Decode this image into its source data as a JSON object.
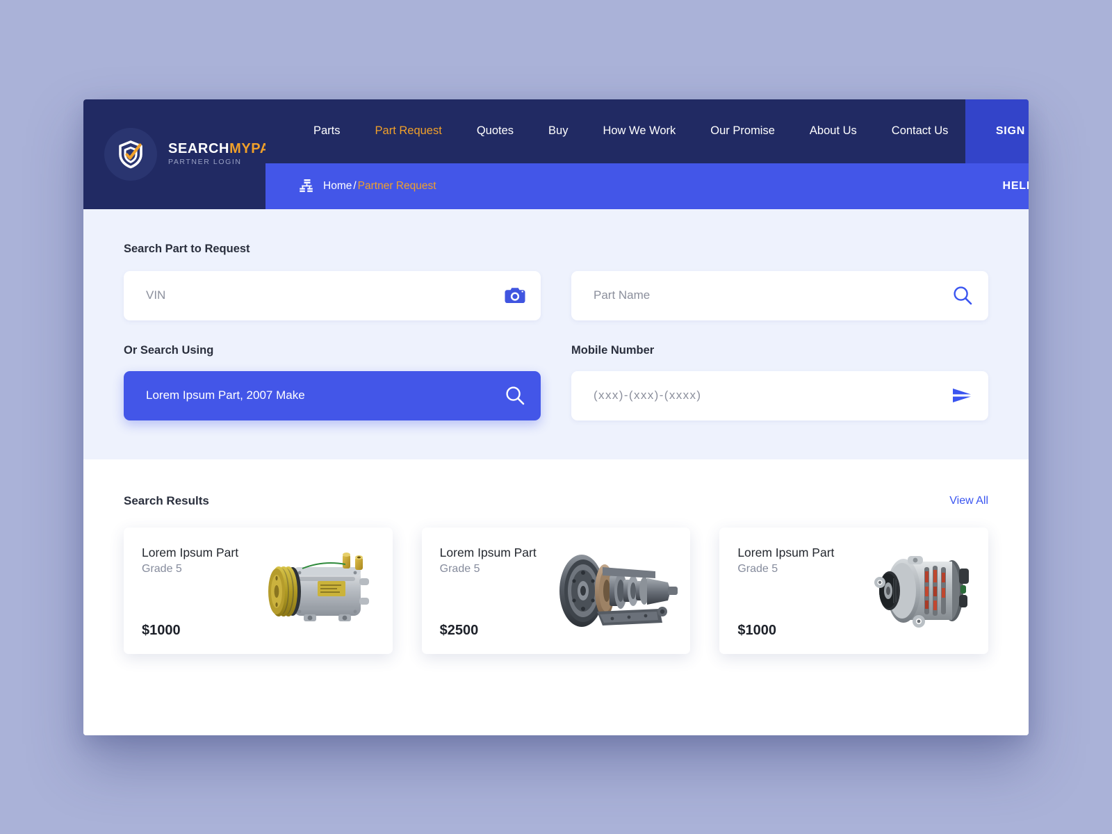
{
  "brand": {
    "name_part1": "SEARCH",
    "name_part2": "MYPART",
    "subtitle": "PARTNER LOGIN",
    "logo_icon": "shield-check-icon"
  },
  "nav": {
    "items": [
      {
        "label": "Parts",
        "active": false
      },
      {
        "label": "Part Request",
        "active": true
      },
      {
        "label": "Quotes",
        "active": false
      },
      {
        "label": "Buy",
        "active": false
      },
      {
        "label": "How We Work",
        "active": false
      },
      {
        "label": "Our Promise",
        "active": false
      },
      {
        "label": "About Us",
        "active": false
      },
      {
        "label": "Contact Us",
        "active": false
      }
    ],
    "signin_label": "SIGN IN",
    "help_label": "HELP"
  },
  "breadcrumb": {
    "icon": "sitemap-icon",
    "home": "Home",
    "separator": "/",
    "current": "Partner Request"
  },
  "search": {
    "heading": "Search Part to Request",
    "vin_placeholder": "VIN",
    "vin_value": "",
    "vin_icon": "camera-icon",
    "part_name_placeholder": "Part Name",
    "part_name_value": "",
    "part_name_icon": "search-icon",
    "or_search_label": "Or Search Using",
    "or_search_value": "Lorem Ipsum Part, 2007 Make",
    "or_search_icon": "search-icon",
    "mobile_label": "Mobile Number",
    "mobile_placeholder": "(xxx)-(xxx)-(xxxx)",
    "mobile_value": "",
    "mobile_icon": "send-icon"
  },
  "results": {
    "title": "Search Results",
    "view_all": "View All",
    "cards": [
      {
        "name": "Lorem Ipsum Part",
        "grade": "Grade 5",
        "price": "$1000",
        "image": "ac-compressor-image"
      },
      {
        "name": "Lorem Ipsum Part",
        "grade": "Grade 5",
        "price": "$2500",
        "image": "transmission-image"
      },
      {
        "name": "Lorem Ipsum Part",
        "grade": "Grade 5",
        "price": "$1000",
        "image": "alternator-image"
      }
    ]
  },
  "colors": {
    "page_background": "#aab2d8",
    "nav_navy": "#212a63",
    "accent_orange": "#f0a02a",
    "primary_blue": "#4356e8",
    "signin_blue": "#3344c9",
    "panel_background": "#eef2fd",
    "link_blue": "#3a55f0"
  }
}
